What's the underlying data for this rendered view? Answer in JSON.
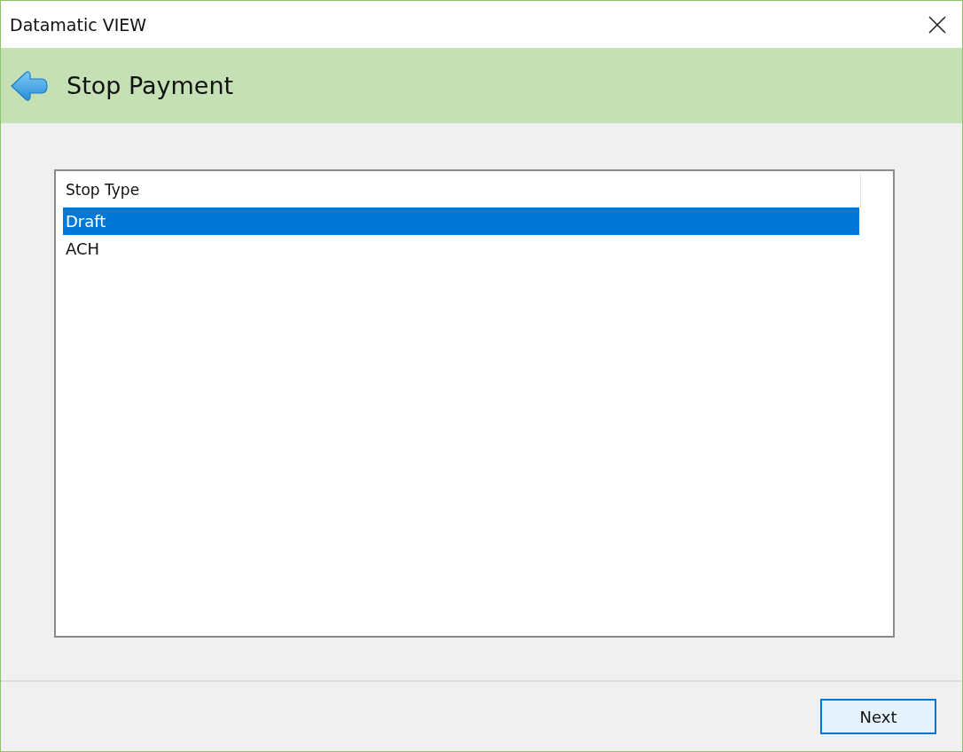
{
  "window": {
    "title": "Datamatic VIEW"
  },
  "header": {
    "title": "Stop Payment"
  },
  "list": {
    "column": "Stop Type",
    "items": [
      {
        "label": "Draft",
        "selected": true
      },
      {
        "label": "ACH",
        "selected": false
      }
    ]
  },
  "buttons": [
    "Next"
  ]
}
